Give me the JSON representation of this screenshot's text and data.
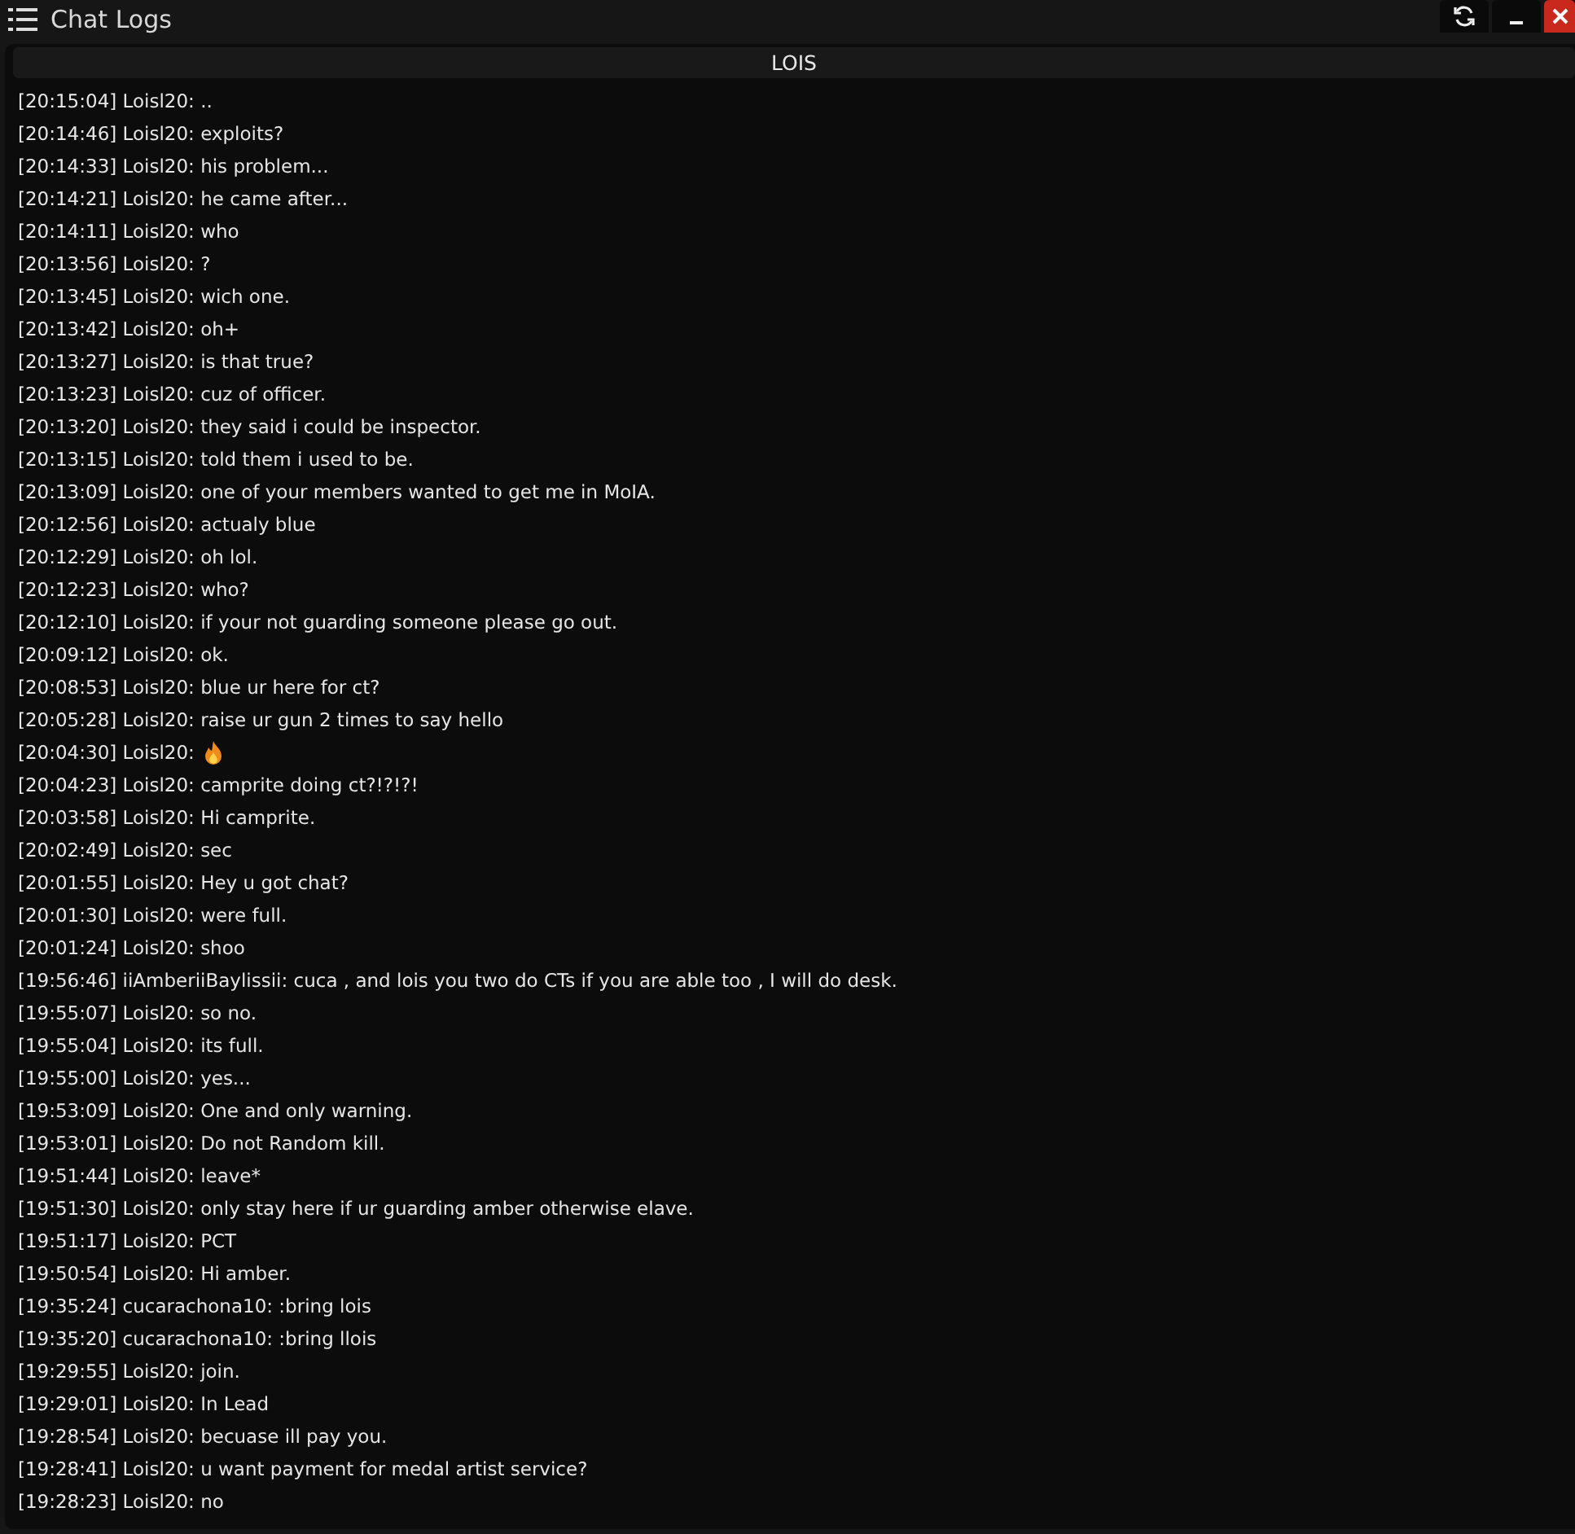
{
  "window": {
    "title": "Chat Logs"
  },
  "panel": {
    "header": "LOIS"
  },
  "messages": [
    {
      "kind": "text",
      "text": "[20:15:04] Loisl20: .."
    },
    {
      "kind": "text",
      "text": "[20:14:46] Loisl20: exploits?"
    },
    {
      "kind": "text",
      "text": "[20:14:33] Loisl20: his problem..."
    },
    {
      "kind": "text",
      "text": "[20:14:21] Loisl20: he came after..."
    },
    {
      "kind": "text",
      "text": "[20:14:11] Loisl20: who"
    },
    {
      "kind": "text",
      "text": "[20:13:56] Loisl20: ?"
    },
    {
      "kind": "text",
      "text": "[20:13:45] Loisl20: wich one."
    },
    {
      "kind": "text",
      "text": "[20:13:42] Loisl20: oh+"
    },
    {
      "kind": "text",
      "text": "[20:13:27] Loisl20: is that true?"
    },
    {
      "kind": "text",
      "text": "[20:13:23] Loisl20: cuz of officer."
    },
    {
      "kind": "text",
      "text": "[20:13:20] Loisl20: they said i could be inspector."
    },
    {
      "kind": "text",
      "text": "[20:13:15] Loisl20: told them i used to be."
    },
    {
      "kind": "text",
      "text": "[20:13:09] Loisl20: one of your members wanted to get me in MoIA."
    },
    {
      "kind": "text",
      "text": "[20:12:56] Loisl20: actualy blue"
    },
    {
      "kind": "text",
      "text": "[20:12:29] Loisl20: oh lol."
    },
    {
      "kind": "text",
      "text": "[20:12:23] Loisl20: who?"
    },
    {
      "kind": "text",
      "text": "[20:12:10] Loisl20: if your not guarding someone please go out."
    },
    {
      "kind": "text",
      "text": "[20:09:12] Loisl20: ok."
    },
    {
      "kind": "text",
      "text": "[20:08:53] Loisl20: blue ur here for ct?"
    },
    {
      "kind": "text",
      "text": "[20:05:28] Loisl20: raise ur gun 2 times to say hello"
    },
    {
      "kind": "emoji",
      "text": "[20:04:30] Loisl20:"
    },
    {
      "kind": "text",
      "text": "[20:04:23] Loisl20: camprite doing ct?!?!?!"
    },
    {
      "kind": "text",
      "text": "[20:03:58] Loisl20: Hi camprite."
    },
    {
      "kind": "text",
      "text": "[20:02:49] Loisl20: sec"
    },
    {
      "kind": "text",
      "text": "[20:01:55] Loisl20: Hey u got chat?"
    },
    {
      "kind": "text",
      "text": "[20:01:30] Loisl20: were full."
    },
    {
      "kind": "text",
      "text": "[20:01:24] Loisl20: shoo"
    },
    {
      "kind": "text",
      "text": "[19:56:46] iiAmberiiBaylissii: cuca , and lois you two do CTs if you are able too , I will do desk."
    },
    {
      "kind": "text",
      "text": "[19:55:07] Loisl20: so no."
    },
    {
      "kind": "text",
      "text": "[19:55:04] Loisl20: its full."
    },
    {
      "kind": "text",
      "text": "[19:55:00] Loisl20: yes..."
    },
    {
      "kind": "text",
      "text": "[19:53:09] Loisl20: One and only warning."
    },
    {
      "kind": "text",
      "text": "[19:53:01] Loisl20: Do not Random kill."
    },
    {
      "kind": "text",
      "text": "[19:51:44] Loisl20: leave*"
    },
    {
      "kind": "text",
      "text": "[19:51:30] Loisl20: only stay here if ur guarding amber otherwise elave."
    },
    {
      "kind": "text",
      "text": "[19:51:17] Loisl20: PCT"
    },
    {
      "kind": "text",
      "text": "[19:50:54] Loisl20: Hi amber."
    },
    {
      "kind": "text",
      "text": "[19:35:24] cucarachona10: :bring lois"
    },
    {
      "kind": "text",
      "text": "[19:35:20] cucarachona10: :bring llois"
    },
    {
      "kind": "text",
      "text": "[19:29:55] Loisl20: join."
    },
    {
      "kind": "text",
      "text": "[19:29:01] Loisl20: In Lead"
    },
    {
      "kind": "text",
      "text": "[19:28:54] Loisl20: becuase ill pay you."
    },
    {
      "kind": "text",
      "text": "[19:28:41] Loisl20: u want payment for medal artist service?"
    },
    {
      "kind": "text",
      "text": "[19:28:23] Loisl20: no"
    }
  ]
}
